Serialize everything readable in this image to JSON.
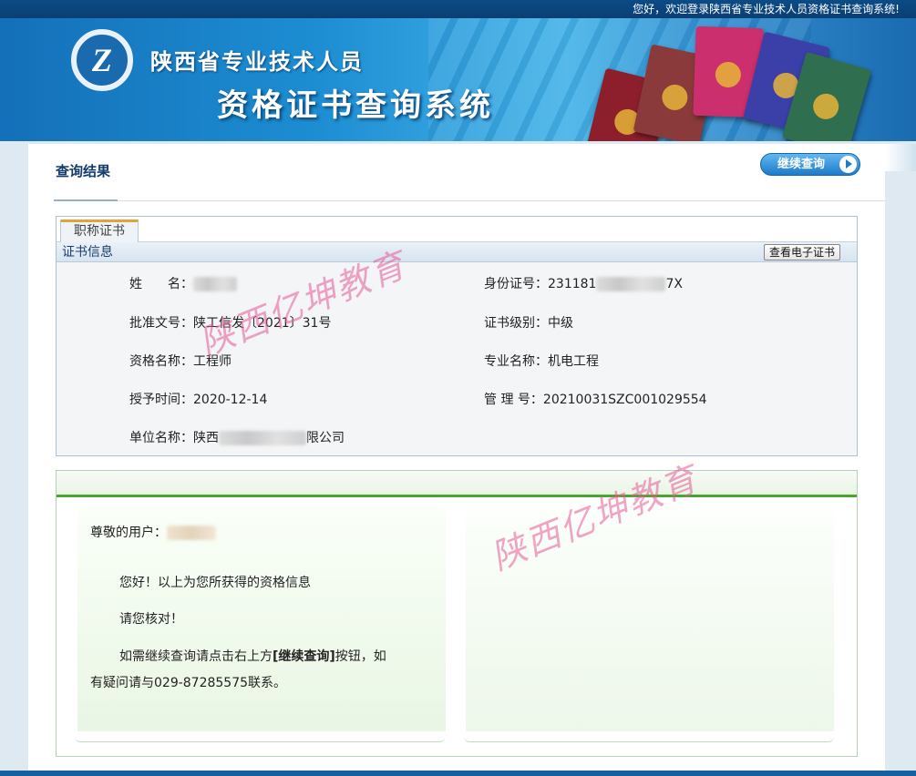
{
  "topbar": {
    "welcome": "您好，欢迎登录陕西省专业技术人员资格证书查询系统!"
  },
  "banner": {
    "logo_letter": "Z",
    "title_line1": "陕西省专业技术人员",
    "title_line2": "资格证书查询系统",
    "book_colors": [
      "#8d1f2c",
      "#8a3a3a",
      "#cc2f6e",
      "#3b3fa8",
      "#2f6e4f"
    ]
  },
  "page": {
    "title": "查询结果",
    "continue_button": "继续查询"
  },
  "cert": {
    "tab": "职称证书",
    "section_title": "证书信息",
    "view_button": "查看电子证书",
    "fields": {
      "name_label": "姓　　名：",
      "id_label": "身份证号：",
      "id_value_start": "231181",
      "id_value_end": "7X",
      "doc_label": "批准文号：",
      "doc_value": "陕工信发〔2021〕31号",
      "level_label": "证书级别：",
      "level_value": "中级",
      "qual_label": "资格名称：",
      "qual_value": "工程师",
      "major_label": "专业名称：",
      "major_value": "机电工程",
      "date_label": "授予时间：",
      "date_value": "2020-12-14",
      "mgmt_label": "管 理 号：",
      "mgmt_value": "20210031SZC001029554",
      "unit_label": "单位名称：",
      "unit_value_start": "陕西",
      "unit_value_end": "限公司"
    }
  },
  "message": {
    "greeting": "尊敬的用户：",
    "line1": "您好！以上为您所获得的资格信息",
    "line2": "请您核对！",
    "line3_pre": "如需继续查询请点击右上方",
    "line3_bold": "[继续查询]",
    "line3_post": "按钮，如",
    "line4": "有疑问请与029-87285575联系。"
  },
  "watermark": {
    "text": "陕西亿坤教育"
  }
}
